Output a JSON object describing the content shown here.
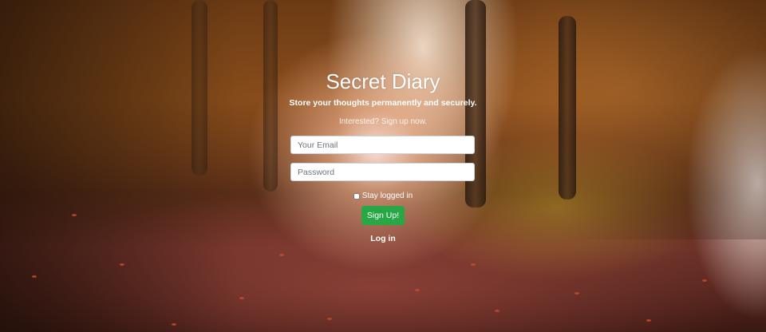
{
  "app": {
    "title": "Secret Diary",
    "tagline": "Store your thoughts permanently and securely.",
    "signup_prompt": "Interested? Sign up now."
  },
  "form": {
    "email_placeholder": "Your Email",
    "email_value": "",
    "password_placeholder": "Password",
    "password_value": "",
    "stay_logged_in_label": "Stay logged in",
    "stay_logged_in_checked": false,
    "submit_label": "Sign Up!",
    "toggle_link_label": "Log in"
  },
  "colors": {
    "submit_button": "#28a745",
    "text": "#ffffff"
  }
}
